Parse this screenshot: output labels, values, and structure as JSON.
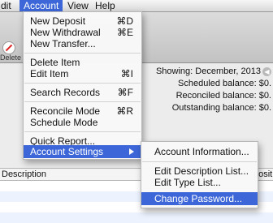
{
  "menubar": {
    "items": [
      {
        "label": "dit"
      },
      {
        "label": "Account"
      },
      {
        "label": "View"
      },
      {
        "label": "Help"
      }
    ]
  },
  "toolbar": {
    "delete_label": "Delete Ite"
  },
  "info": {
    "showing": "Showing: December, 2013",
    "scheduled": "Scheduled balance: $0.",
    "reconciled": "Reconciled balance: $0.",
    "outstanding": "Outstanding balance: $0."
  },
  "table": {
    "col_description": "Description",
    "col_deposit": "posit"
  },
  "account_menu": {
    "new_deposit": {
      "label": "New Deposit",
      "shortcut": "⌘D"
    },
    "new_withdrawal": {
      "label": "New Withdrawal",
      "shortcut": "⌘E"
    },
    "new_transfer": {
      "label": "New Transfer..."
    },
    "delete_item": {
      "label": "Delete Item"
    },
    "edit_item": {
      "label": "Edit Item",
      "shortcut": "⌘I"
    },
    "search_records": {
      "label": "Search Records",
      "shortcut": "⌘F"
    },
    "reconcile_mode": {
      "label": "Reconcile Mode",
      "shortcut": "⌘R"
    },
    "schedule_mode": {
      "label": "Schedule Mode"
    },
    "quick_report": {
      "label": "Quick Report..."
    },
    "account_settings": {
      "label": "Account Settings"
    }
  },
  "settings_submenu": {
    "account_information": "Account Information...",
    "edit_description_list": "Edit Description List...",
    "edit_type_list": "Edit Type List...",
    "change_password": "Change Password..."
  },
  "colors": {
    "highlight": "#3d67d8",
    "delete_icon": "#d22222"
  }
}
